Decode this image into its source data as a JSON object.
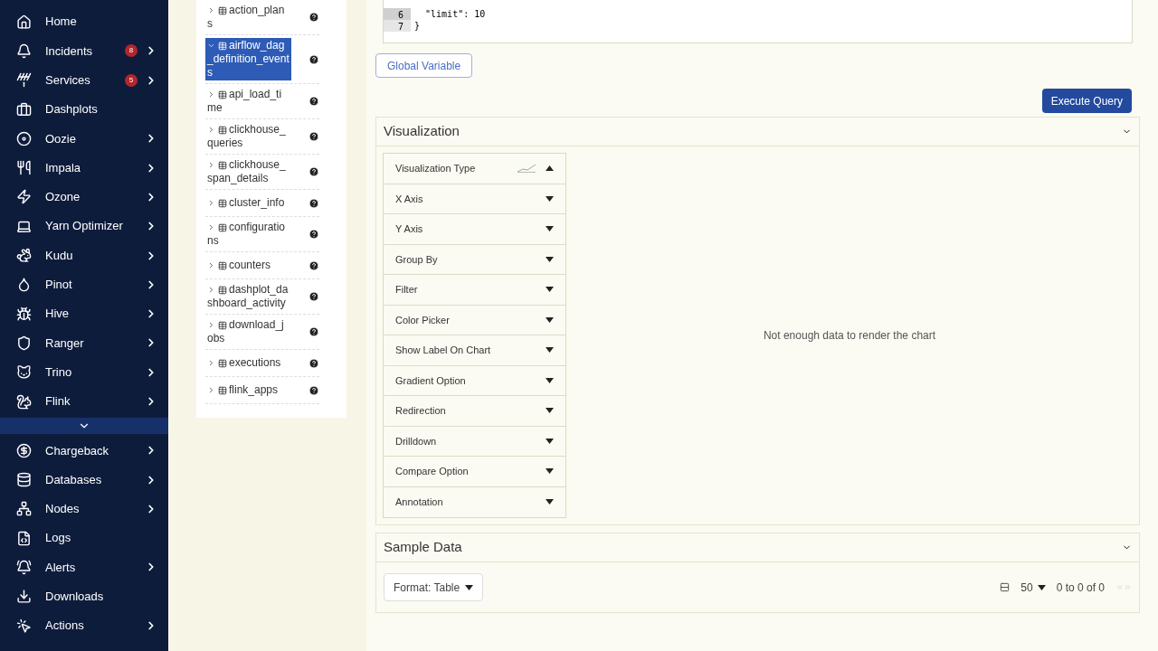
{
  "sidebar": {
    "items": [
      {
        "label": "Home",
        "expandable": false
      },
      {
        "label": "Incidents",
        "badge": "8",
        "expandable": true
      },
      {
        "label": "Services",
        "badge": "5",
        "expandable": true
      },
      {
        "label": "Dashplots",
        "expandable": false
      },
      {
        "label": "Oozie",
        "expandable": true
      },
      {
        "label": "Impala",
        "expandable": true
      },
      {
        "label": "Ozone",
        "expandable": true
      },
      {
        "label": "Yarn Optimizer",
        "expandable": true
      },
      {
        "label": "Kudu",
        "expandable": true
      },
      {
        "label": "Pinot",
        "expandable": true
      },
      {
        "label": "Hive",
        "expandable": true
      },
      {
        "label": "Ranger",
        "expandable": true
      },
      {
        "label": "Trino",
        "expandable": true
      },
      {
        "label": "Flink",
        "expandable": true
      },
      {
        "kind": "more"
      },
      {
        "label": "Chargeback",
        "expandable": true
      },
      {
        "label": "Databases",
        "expandable": true
      },
      {
        "label": "Nodes",
        "expandable": true
      },
      {
        "label": "Logs",
        "expandable": false
      },
      {
        "label": "Alerts",
        "expandable": true
      },
      {
        "label": "Downloads",
        "expandable": false
      },
      {
        "label": "Actions",
        "expandable": true
      }
    ]
  },
  "tables": [
    {
      "label": "action_plans",
      "selected": false,
      "expanded": false
    },
    {
      "label": "airflow_dag_definition_events",
      "selected": true,
      "expanded": true
    },
    {
      "label": "api_load_time",
      "selected": false,
      "expanded": false
    },
    {
      "label": "clickhouse_queries",
      "selected": false,
      "expanded": false
    },
    {
      "label": "clickhouse_span_details",
      "selected": false,
      "expanded": false
    },
    {
      "label": "cluster_info",
      "selected": false,
      "expanded": false
    },
    {
      "label": "configurations",
      "selected": false,
      "expanded": false
    },
    {
      "label": "counters",
      "selected": false,
      "expanded": false
    },
    {
      "label": "dashplot_dashboard_activity",
      "selected": false,
      "expanded": false
    },
    {
      "label": "download_jobs",
      "selected": false,
      "expanded": false
    },
    {
      "label": "executions",
      "selected": false,
      "expanded": false
    },
    {
      "label": "flink_apps",
      "selected": false,
      "expanded": false
    }
  ],
  "editor": {
    "lines": [
      {
        "number": "6",
        "text": "  \"limit\": 10",
        "active": true
      },
      {
        "number": "7",
        "text": "}",
        "active": false
      }
    ]
  },
  "global_variable_button": "Global Variable",
  "execute_button": "Execute Query",
  "visualization": {
    "title": "Visualization",
    "options": [
      {
        "label": "Visualization Type",
        "expanded": true
      },
      {
        "label": "X Axis",
        "expanded": false
      },
      {
        "label": "Y Axis",
        "expanded": false
      },
      {
        "label": "Group By",
        "expanded": false
      },
      {
        "label": "Filter",
        "expanded": false
      },
      {
        "label": "Color Picker",
        "expanded": false
      },
      {
        "label": "Show Label On Chart",
        "expanded": false
      },
      {
        "label": "Gradient Option",
        "expanded": false
      },
      {
        "label": "Redirection",
        "expanded": false
      },
      {
        "label": "Drilldown",
        "expanded": false
      },
      {
        "label": "Compare Option",
        "expanded": false
      },
      {
        "label": "Annotation",
        "expanded": false
      }
    ],
    "message": "Not enough data to render the chart"
  },
  "sample_data": {
    "title": "Sample Data",
    "format_button": "Format: Table",
    "page_size": "50",
    "range": "0 to 0 of 0"
  }
}
